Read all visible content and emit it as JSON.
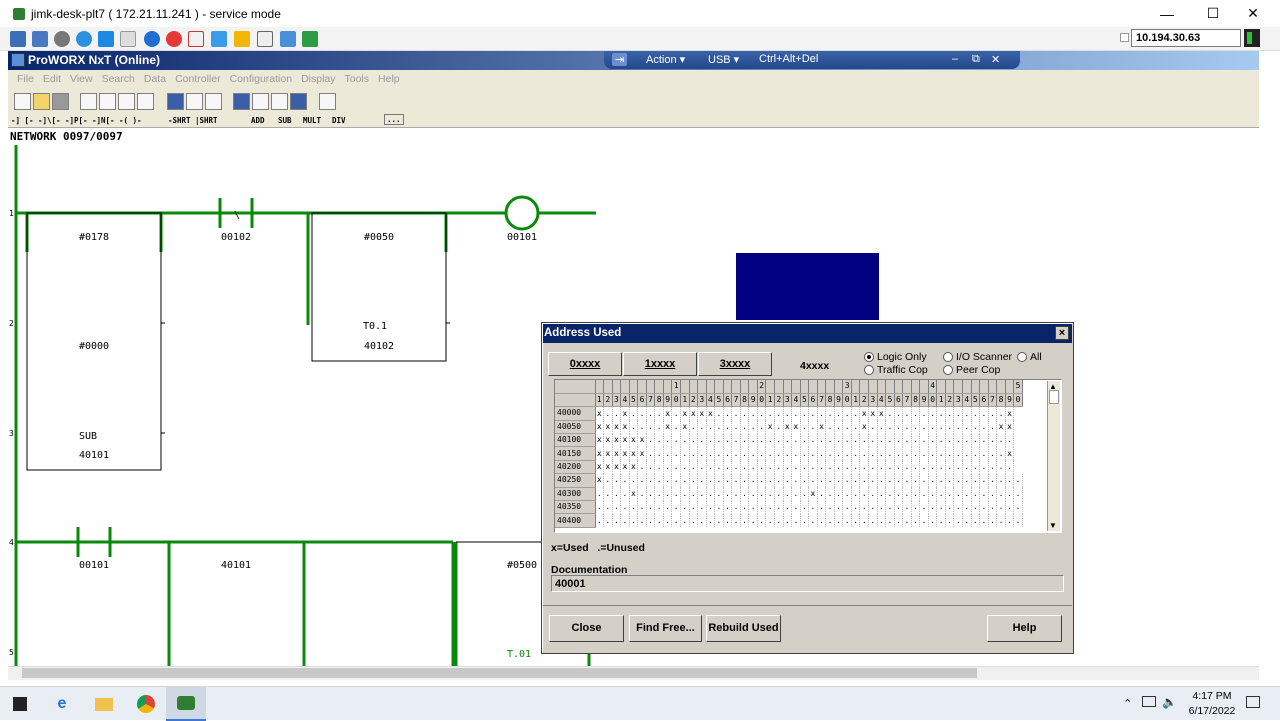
{
  "window": {
    "title": "jimk-desk-plt7 ( 172.21.11.241 ) - service mode",
    "minimize_glyph": "—",
    "maximize_glyph": "☐",
    "close_glyph": "✕"
  },
  "remote_toolbar": {
    "ip": "10.194.30.63"
  },
  "app": {
    "title": "ProWORX NxT (Online)"
  },
  "kvm": {
    "pin": "⇥",
    "action": "Action ▾",
    "usb": "USB ▾",
    "cad": "Ctrl+Alt+Del",
    "min": "–",
    "restore": "⧉",
    "close": "✕"
  },
  "menu": [
    "File",
    "Edit",
    "View",
    "Search",
    "Data",
    "Controller",
    "Configuration",
    "Display",
    "Tools",
    "Help"
  ],
  "instr_bar": [
    "-] [-",
    "-]\\[-",
    "-]P[-",
    "-]N[-",
    "-( )-",
    "-SHRT",
    "|SHRT",
    "ADD",
    "SUB",
    "MULT",
    "DIV",
    "..."
  ],
  "network": "NETWORK 0097/0097",
  "ladder": {
    "rung_numbers": [
      "1",
      "2",
      "3",
      "4",
      "5"
    ],
    "labels": {
      "b1_top": "#0178",
      "b1_mid": "#0000",
      "b1_op": "SUB",
      "b1_bot": "40101",
      "contact1": "00102",
      "contact1_sym": "\\",
      "b2_top": "#0050",
      "b2_t": "T0.1",
      "b2_bot": "40102",
      "coil": "00101",
      "contact2": "00101",
      "b3": "40101",
      "b4": "#0500",
      "t01": "T.01"
    }
  },
  "dialog": {
    "title": "Address Used",
    "close": "×",
    "tabs": [
      "0xxxx",
      "1xxxx",
      "3xxxx"
    ],
    "tab4": "4xxxx",
    "radios": [
      {
        "label": "Logic Only",
        "checked": true
      },
      {
        "label": "I/O Scanner",
        "checked": false
      },
      {
        "label": "All",
        "checked": false
      },
      {
        "label": "Traffic Cop",
        "checked": false
      },
      {
        "label": "Peer Cop",
        "checked": false
      }
    ],
    "col_decades": [
      "",
      "",
      "",
      "",
      "",
      "",
      "",
      "",
      "",
      "1",
      "",
      "",
      "",
      "",
      "",
      "",
      "",
      "",
      "",
      "2",
      "",
      "",
      "",
      "",
      "",
      "",
      "",
      "",
      "",
      "3",
      "",
      "",
      "",
      "",
      "",
      "",
      "",
      "",
      "",
      "4",
      "",
      "",
      "",
      "",
      "",
      "",
      "",
      "",
      "",
      "5"
    ],
    "col_digits": "12345678901234567890123456789012345678901234567890",
    "rows": [
      {
        "addr": "40000",
        "cells": "x..x....x.xxxx.................xxx..............x"
      },
      {
        "addr": "40050",
        "cells": "xxxx....x.x.........x.xx..x....x...............xx"
      },
      {
        "addr": "40100",
        "cells": "xxxxxx..........................................."
      },
      {
        "addr": "40150",
        "cells": "xxxxxx..........................................x"
      },
      {
        "addr": "40200",
        "cells": "xxxxx............................................"
      },
      {
        "addr": "40250",
        "cells": "x................................................."
      },
      {
        "addr": "40300",
        "cells": "....x....................x........................"
      },
      {
        "addr": "40350",
        "cells": ".................................................."
      },
      {
        "addr": "40400",
        "cells": ".................................................."
      }
    ],
    "legend": "x=Used   .=Unused",
    "doc_label": "Documentation",
    "doc_value": "40001",
    "buttons": {
      "close": "Close",
      "find": "Find Free...",
      "rebuild": "Rebuild Used",
      "help": "Help"
    }
  },
  "taskbar": {
    "time": "4:17 PM",
    "date": "6/17/2022"
  },
  "colors": {
    "ladder_green": "#0a8a0a",
    "title_blue": "#0a246a",
    "dark_block": "#000080"
  }
}
